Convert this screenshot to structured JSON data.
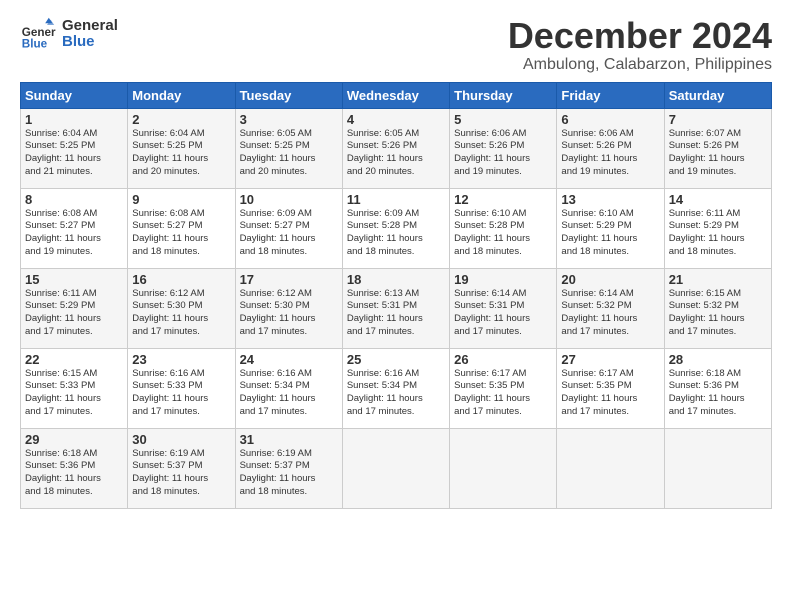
{
  "logo": {
    "line1": "General",
    "line2": "Blue"
  },
  "title": "December 2024",
  "location": "Ambulong, Calabarzon, Philippines",
  "header_days": [
    "Sunday",
    "Monday",
    "Tuesday",
    "Wednesday",
    "Thursday",
    "Friday",
    "Saturday"
  ],
  "weeks": [
    [
      {
        "day": "1",
        "lines": [
          "Sunrise: 6:04 AM",
          "Sunset: 5:25 PM",
          "Daylight: 11 hours",
          "and 21 minutes."
        ]
      },
      {
        "day": "2",
        "lines": [
          "Sunrise: 6:04 AM",
          "Sunset: 5:25 PM",
          "Daylight: 11 hours",
          "and 20 minutes."
        ]
      },
      {
        "day": "3",
        "lines": [
          "Sunrise: 6:05 AM",
          "Sunset: 5:25 PM",
          "Daylight: 11 hours",
          "and 20 minutes."
        ]
      },
      {
        "day": "4",
        "lines": [
          "Sunrise: 6:05 AM",
          "Sunset: 5:26 PM",
          "Daylight: 11 hours",
          "and 20 minutes."
        ]
      },
      {
        "day": "5",
        "lines": [
          "Sunrise: 6:06 AM",
          "Sunset: 5:26 PM",
          "Daylight: 11 hours",
          "and 19 minutes."
        ]
      },
      {
        "day": "6",
        "lines": [
          "Sunrise: 6:06 AM",
          "Sunset: 5:26 PM",
          "Daylight: 11 hours",
          "and 19 minutes."
        ]
      },
      {
        "day": "7",
        "lines": [
          "Sunrise: 6:07 AM",
          "Sunset: 5:26 PM",
          "Daylight: 11 hours",
          "and 19 minutes."
        ]
      }
    ],
    [
      {
        "day": "8",
        "lines": [
          "Sunrise: 6:08 AM",
          "Sunset: 5:27 PM",
          "Daylight: 11 hours",
          "and 19 minutes."
        ]
      },
      {
        "day": "9",
        "lines": [
          "Sunrise: 6:08 AM",
          "Sunset: 5:27 PM",
          "Daylight: 11 hours",
          "and 18 minutes."
        ]
      },
      {
        "day": "10",
        "lines": [
          "Sunrise: 6:09 AM",
          "Sunset: 5:27 PM",
          "Daylight: 11 hours",
          "and 18 minutes."
        ]
      },
      {
        "day": "11",
        "lines": [
          "Sunrise: 6:09 AM",
          "Sunset: 5:28 PM",
          "Daylight: 11 hours",
          "and 18 minutes."
        ]
      },
      {
        "day": "12",
        "lines": [
          "Sunrise: 6:10 AM",
          "Sunset: 5:28 PM",
          "Daylight: 11 hours",
          "and 18 minutes."
        ]
      },
      {
        "day": "13",
        "lines": [
          "Sunrise: 6:10 AM",
          "Sunset: 5:29 PM",
          "Daylight: 11 hours",
          "and 18 minutes."
        ]
      },
      {
        "day": "14",
        "lines": [
          "Sunrise: 6:11 AM",
          "Sunset: 5:29 PM",
          "Daylight: 11 hours",
          "and 18 minutes."
        ]
      }
    ],
    [
      {
        "day": "15",
        "lines": [
          "Sunrise: 6:11 AM",
          "Sunset: 5:29 PM",
          "Daylight: 11 hours",
          "and 17 minutes."
        ]
      },
      {
        "day": "16",
        "lines": [
          "Sunrise: 6:12 AM",
          "Sunset: 5:30 PM",
          "Daylight: 11 hours",
          "and 17 minutes."
        ]
      },
      {
        "day": "17",
        "lines": [
          "Sunrise: 6:12 AM",
          "Sunset: 5:30 PM",
          "Daylight: 11 hours",
          "and 17 minutes."
        ]
      },
      {
        "day": "18",
        "lines": [
          "Sunrise: 6:13 AM",
          "Sunset: 5:31 PM",
          "Daylight: 11 hours",
          "and 17 minutes."
        ]
      },
      {
        "day": "19",
        "lines": [
          "Sunrise: 6:14 AM",
          "Sunset: 5:31 PM",
          "Daylight: 11 hours",
          "and 17 minutes."
        ]
      },
      {
        "day": "20",
        "lines": [
          "Sunrise: 6:14 AM",
          "Sunset: 5:32 PM",
          "Daylight: 11 hours",
          "and 17 minutes."
        ]
      },
      {
        "day": "21",
        "lines": [
          "Sunrise: 6:15 AM",
          "Sunset: 5:32 PM",
          "Daylight: 11 hours",
          "and 17 minutes."
        ]
      }
    ],
    [
      {
        "day": "22",
        "lines": [
          "Sunrise: 6:15 AM",
          "Sunset: 5:33 PM",
          "Daylight: 11 hours",
          "and 17 minutes."
        ]
      },
      {
        "day": "23",
        "lines": [
          "Sunrise: 6:16 AM",
          "Sunset: 5:33 PM",
          "Daylight: 11 hours",
          "and 17 minutes."
        ]
      },
      {
        "day": "24",
        "lines": [
          "Sunrise: 6:16 AM",
          "Sunset: 5:34 PM",
          "Daylight: 11 hours",
          "and 17 minutes."
        ]
      },
      {
        "day": "25",
        "lines": [
          "Sunrise: 6:16 AM",
          "Sunset: 5:34 PM",
          "Daylight: 11 hours",
          "and 17 minutes."
        ]
      },
      {
        "day": "26",
        "lines": [
          "Sunrise: 6:17 AM",
          "Sunset: 5:35 PM",
          "Daylight: 11 hours",
          "and 17 minutes."
        ]
      },
      {
        "day": "27",
        "lines": [
          "Sunrise: 6:17 AM",
          "Sunset: 5:35 PM",
          "Daylight: 11 hours",
          "and 17 minutes."
        ]
      },
      {
        "day": "28",
        "lines": [
          "Sunrise: 6:18 AM",
          "Sunset: 5:36 PM",
          "Daylight: 11 hours",
          "and 17 minutes."
        ]
      }
    ],
    [
      {
        "day": "29",
        "lines": [
          "Sunrise: 6:18 AM",
          "Sunset: 5:36 PM",
          "Daylight: 11 hours",
          "and 18 minutes."
        ]
      },
      {
        "day": "30",
        "lines": [
          "Sunrise: 6:19 AM",
          "Sunset: 5:37 PM",
          "Daylight: 11 hours",
          "and 18 minutes."
        ]
      },
      {
        "day": "31",
        "lines": [
          "Sunrise: 6:19 AM",
          "Sunset: 5:37 PM",
          "Daylight: 11 hours",
          "and 18 minutes."
        ]
      },
      null,
      null,
      null,
      null
    ]
  ]
}
